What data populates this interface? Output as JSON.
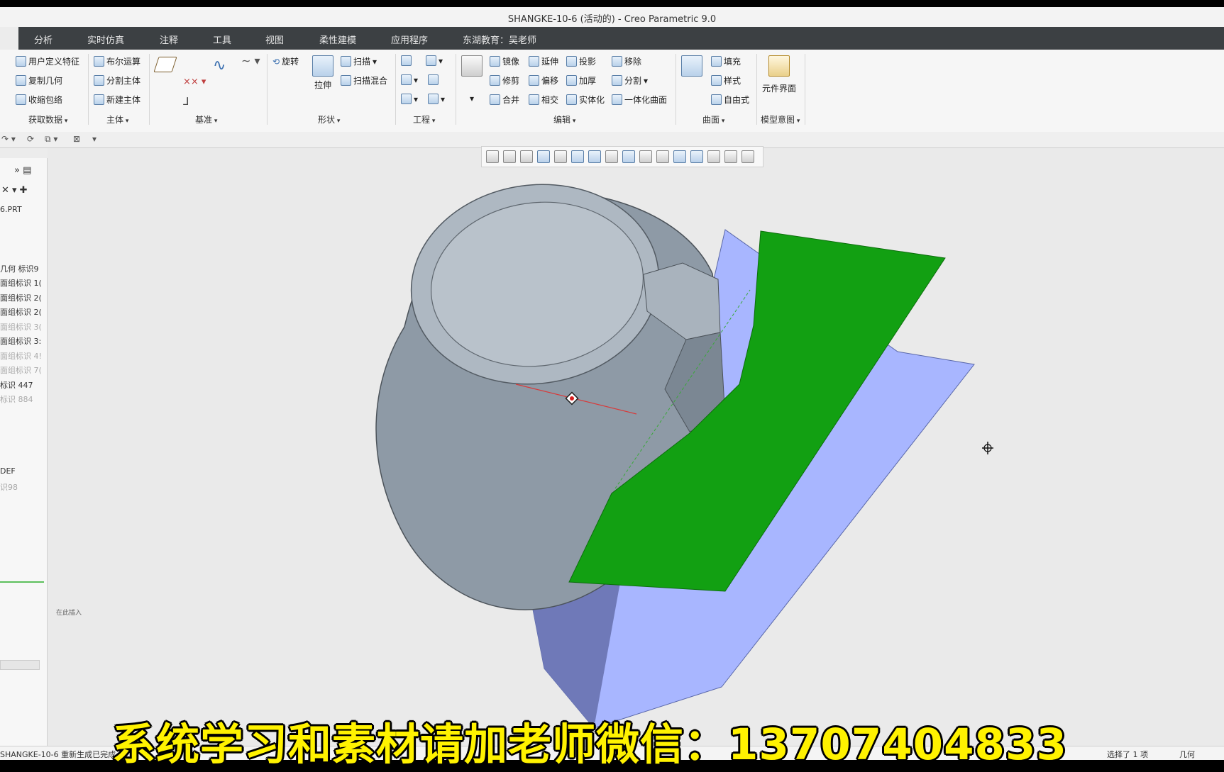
{
  "window": {
    "title": "SHANGKE-10-6 (活动的) - Creo Parametric 9.0"
  },
  "menu": [
    {
      "label": "分析"
    },
    {
      "label": "实时仿真"
    },
    {
      "label": "注释"
    },
    {
      "label": "工具"
    },
    {
      "label": "视图"
    },
    {
      "label": "柔性建模"
    },
    {
      "label": "应用程序"
    },
    {
      "label": "东湖教育：吴老师"
    }
  ],
  "ribbon": {
    "get_data": {
      "items": [
        "用户定义特征",
        "复制几何",
        "收缩包络"
      ],
      "label": "获取数据"
    },
    "body": {
      "items": [
        "布尔运算",
        "分割主体",
        "新建主体"
      ],
      "label": "主体"
    },
    "datum": {
      "label": "基准"
    },
    "shapes": {
      "revolve": "旋转",
      "extrude": "拉伸",
      "sweep": "扫描",
      "swept_blend": "扫描混合",
      "label": "形状"
    },
    "engineering": {
      "label": "工程"
    },
    "editing": {
      "items": [
        "镜像",
        "延伸",
        "投影",
        "移除",
        "修剪",
        "偏移",
        "加厚",
        "分割",
        "合并",
        "相交",
        "实体化",
        "一体化曲面"
      ],
      "label": "编辑"
    },
    "surfaces": {
      "items": [
        "填充",
        "样式",
        "自由式"
      ],
      "label": "曲面"
    },
    "model_intent": {
      "item": "元件界面",
      "label": "模型意图"
    }
  },
  "tree": {
    "model": "6.PRT",
    "rows": [
      {
        "text": "几何 标识9",
        "dim": false
      },
      {
        "text": "面组标识 1(",
        "dim": false
      },
      {
        "text": "面组标识 2(",
        "dim": false
      },
      {
        "text": "面组标识 2(",
        "dim": false
      },
      {
        "text": "面组标识 3(",
        "dim": true
      },
      {
        "text": "面组标识 3:",
        "dim": false
      },
      {
        "text": "面组标识 4!",
        "dim": true
      },
      {
        "text": "面组标识 7(",
        "dim": true
      },
      {
        "text": "标识 447",
        "dim": false
      },
      {
        "text": "标识 884",
        "dim": true
      }
    ],
    "def": "DEF",
    "id98": "识98",
    "insert": "在此插入"
  },
  "status": {
    "left": "SHANGKE-10-6 重新生成已完成。",
    "selected": "选择了 1 项",
    "filter": "几何"
  },
  "overlay": {
    "text": "系统学习和素材请加老师微信：13707404833"
  },
  "colors": {
    "menubar": "#3c4043",
    "green_surface": "#12a012",
    "blue_surface": "#a8b6ff",
    "model_grey": "#8e9aa6",
    "banner_text": "#fff200"
  }
}
